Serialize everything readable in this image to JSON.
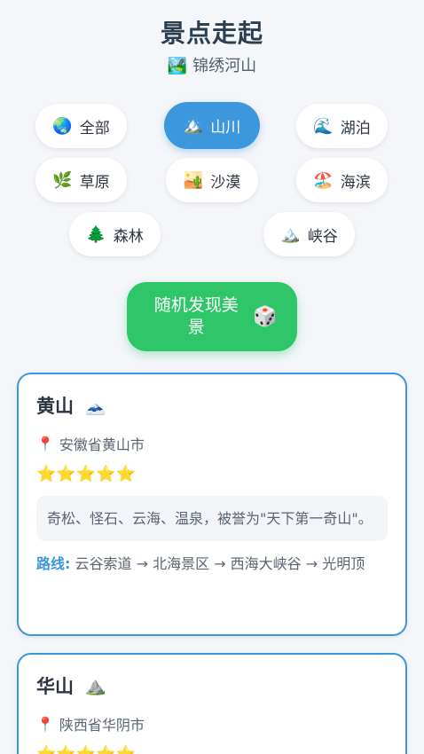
{
  "header": {
    "title": "景点走起",
    "subtitle_icon": "🏞️",
    "subtitle": "锦绣河山"
  },
  "categories": [
    {
      "icon": "🌏",
      "label": "全部",
      "active": false
    },
    {
      "icon": "🏔️",
      "label": "山川",
      "active": true
    },
    {
      "icon": "🌊",
      "label": "湖泊",
      "active": false
    },
    {
      "icon": "🌿",
      "label": "草原",
      "active": false
    },
    {
      "icon": "🏜️",
      "label": "沙漠",
      "active": false
    },
    {
      "icon": "🏖️",
      "label": "海滨",
      "active": false
    },
    {
      "icon": "🌲",
      "label": "森林",
      "active": false
    },
    {
      "icon": "🏔️",
      "label": "峡谷",
      "active": false
    }
  ],
  "random_button": {
    "label": "随机发现美景",
    "icon": "🎲"
  },
  "spots": [
    {
      "name": "黄山",
      "icon": "🗻",
      "pin_icon": "📍",
      "location": "安徽省黄山市",
      "stars": "⭐⭐⭐⭐⭐",
      "rating": 5,
      "description": "奇松、怪石、云海、温泉，被誉为\"天下第一奇山\"。",
      "route_label": "路线:",
      "route": "云谷索道 → 北海景区 → 西海大峡谷 → 光明顶"
    },
    {
      "name": "华山",
      "icon": "⛰️",
      "pin_icon": "📍",
      "location": "陕西省华阴市",
      "stars": "⭐⭐⭐⭐⭐",
      "rating": 5
    }
  ],
  "colors": {
    "accent": "#3d97dc",
    "primary_button": "#2fc669",
    "star": "#f6c21c"
  }
}
